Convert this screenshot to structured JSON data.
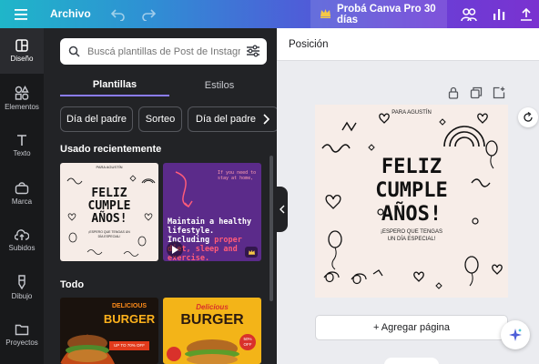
{
  "topbar": {
    "file_menu": "Archivo",
    "pro_button": "Probá Canva Pro 30 días",
    "icons": [
      "menu-icon",
      "undo-icon",
      "redo-icon",
      "crown-icon",
      "share-people-icon",
      "chart-icon",
      "upload-icon"
    ]
  },
  "rail": {
    "items": [
      {
        "label": "Diseño",
        "icon": "layout-icon"
      },
      {
        "label": "Elementos",
        "icon": "shapes-icon"
      },
      {
        "label": "Texto",
        "icon": "text-icon"
      },
      {
        "label": "Marca",
        "icon": "brand-icon"
      },
      {
        "label": "Subidos",
        "icon": "cloud-upload-icon"
      },
      {
        "label": "Dibujo",
        "icon": "pen-icon"
      },
      {
        "label": "Proyectos",
        "icon": "folder-icon"
      }
    ]
  },
  "panel": {
    "search": {
      "placeholder": "Buscá plantillas de Post de Instagram"
    },
    "tabs": [
      "Plantillas",
      "Estilos"
    ],
    "chips": [
      "Día del padre",
      "Sorteo",
      "Día del padre"
    ],
    "recent_title": "Usado recientemente",
    "all_title": "Todo",
    "thumb1": {
      "top": "PARA AGUSTÍN",
      "line1": "FELIZ",
      "line2": "CUMPLE",
      "line3": "AÑOS!",
      "bottom": "¡ESPERO QUE TENGAS UN DÍA ESPECIAL!"
    },
    "thumb2": {
      "small": "If you need to stay at home,",
      "headline": "Maintain a healthy lifestyle. Including ",
      "highlight": "proper diet, sleep and exercise."
    },
    "thumb3": {
      "line1": "DELICIOUS",
      "line2": "BURGER",
      "badge": "UP TO 70% OFF"
    },
    "thumb4": {
      "line1": "Delicious",
      "line2": "BURGER",
      "badge": "50% OFF"
    }
  },
  "editor": {
    "context_label": "Posición",
    "card": {
      "top": "PARA AGUSTÍN",
      "line1": "FELIZ",
      "line2": "CUMPLE",
      "line3": "AÑOS!",
      "bottom1": "¡ESPERO QUE TENGAS",
      "bottom2": "UN DÍA ESPECIAL!"
    },
    "add_page": "+ Agregar página"
  },
  "colors": {
    "topbar_start": "#1fb6c9",
    "topbar_end": "#7a32d0",
    "tab_underline": "#8b7cf6",
    "panel_bg": "#222326",
    "canvas_bg": "#f7ede8"
  }
}
